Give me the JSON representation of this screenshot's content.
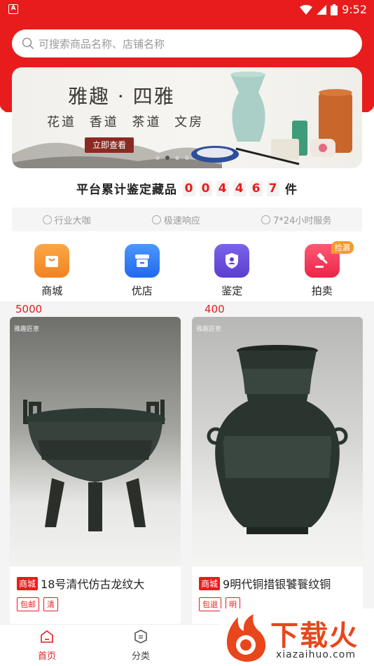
{
  "status": {
    "time": "9:52",
    "left_icon": "A"
  },
  "search": {
    "placeholder": "可搜索商品名称、店铺名称"
  },
  "banner": {
    "title": "雅趣 · 四雅",
    "subtitle": "花道 香道 茶道 文房",
    "button": "立即查看"
  },
  "counter": {
    "prefix": "平台累计鉴定藏品",
    "digits": [
      "0",
      "0",
      "4",
      "4",
      "6",
      "7"
    ],
    "suffix": "件"
  },
  "features": [
    "行业大咖",
    "极速响应",
    "7*24小时服务"
  ],
  "nav": [
    {
      "label": "商城",
      "icon": "bag-icon",
      "color": "#f4922a"
    },
    {
      "label": "优店",
      "icon": "shop-icon",
      "color": "#2f7cf6"
    },
    {
      "label": "鉴定",
      "icon": "shield-user-icon",
      "color": "#6b4fd8"
    },
    {
      "label": "拍卖",
      "icon": "gavel-icon",
      "color": "#f23d5b",
      "badge": "捡漏"
    }
  ],
  "products": [
    {
      "watermark": "雅趣匠意",
      "tag": "商城",
      "title": "18号清代仿古龙纹大",
      "badges": [
        "包邮",
        "清"
      ],
      "price": "5000"
    },
    {
      "watermark": "雅趣匠意",
      "tag": "商城",
      "title": "9明代铜措银饕餮纹铜",
      "badges": [
        "包退",
        "明"
      ],
      "price": "400"
    }
  ],
  "tabs": [
    {
      "label": "首页",
      "active": true
    },
    {
      "label": "分类",
      "active": false
    }
  ],
  "watermark": {
    "name": "下载火",
    "url": "xiazaihuo.com"
  },
  "colors": {
    "primary": "#e81c1c"
  }
}
